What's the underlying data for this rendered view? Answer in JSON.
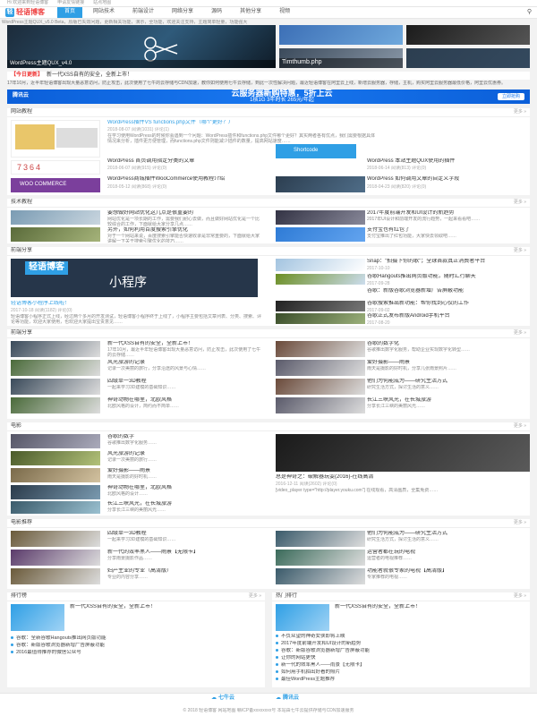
{
  "top_bar": [
    "Hi 欢迎来到轻语博客",
    "申请友情链接",
    "站点地图"
  ],
  "logo": {
    "text": "轻语博客",
    "mark": "轻"
  },
  "nav": {
    "items": [
      "首页",
      "网站技术",
      "前端设计",
      "网络分享",
      "源码",
      "其他分享",
      "视频"
    ],
    "active": 0
  },
  "notice": "WordPress主题QUX_v5.0 Beta，原版已失效问题，更新相关功能，演示，全功能，欢迎关注支持，主题简单轻量，功能强大",
  "hero": {
    "slides": [
      {
        "caption": "WordPress主题QUX_v4.0"
      },
      {
        "caption": "Timthumb.php"
      },
      {
        "caption": ""
      },
      {
        "caption": ""
      },
      {
        "caption": ""
      }
    ]
  },
  "ticker": {
    "tag": "【今日更新】",
    "headline": "新一代XSS自有的安全，全新上市！"
  },
  "ticker_excerpt": "17年10月，近半年轻语博客出现大量恶意访问，防止攻击，此次使用了七牛的云存储与CDN加速，教你如何使用七牛云存储，到此一次性解决问题，最近轻语博客在阿里云上线，新增云服务器，存储，主机，购买阿里云服务器最低价格，阿里云优惠券。",
  "ad": {
    "brand": "腾讯云",
    "line1": "云服务器新购特惠，5折上云",
    "line2": "1核1G 3年时长 265元/年起",
    "button": "立即抢购"
  },
  "more": "更多 »",
  "s1": {
    "title": "网站教程",
    "featured": {
      "title": "WordPress插件VS functions.php文件（哪个更好？）",
      "meta": "2018-08-07    阅读(1031)    评论(1)",
      "excerpt": "在学习使用WordPress的时候你会遇到一个问题：WordPress插件和functions.php文件哪个更好？其实两者各有优点，我们需要根据具体情况来分析，插件更方便管理，而functions.php文件则能减少插件的数量，提高网站速度……"
    },
    "banner_text": "Shortcode",
    "side_top": {
      "title": "WordPress 本站主题QUX使用的插件",
      "meta": "2018-06-14    阅读(813)    评论(0)"
    },
    "grid": [
      {
        "title": "WordPress 首页调用指定分类的文章",
        "meta": "2018-06-07    阅读(915)    评论(0)"
      },
      {
        "title": "WordPress商城插件WooCommerce使用教程介绍",
        "meta": "2018-05-12    阅读(868)    评论(0)"
      },
      {
        "title": "WordPress 如何调用文章的自定义字段",
        "meta": "2018-04-23    阅读(820)    评论(0)"
      }
    ]
  },
  "s2": {
    "title": "技术教程",
    "items": [
      {
        "title": "要想做好网站优化这几点是很重要的",
        "excerpt": "网站优化是一项长期的工作，需要我们耐心去做，而且做好网站优化是一个比较综合的工作，下面就给大家分享几点……"
      },
      {
        "title": "另外，如何利用百度搜索引擎优化",
        "excerpt": "对于一个网站来说，百度搜索引擎能否快速收录是非常重要的，下面就给大家讲解一下关于搜索引擎优化的技巧……"
      },
      {
        "title": "2017年度前端开发和UI设计的新趋势",
        "excerpt": "2017年UI设计和前端开发的流行趋势，一起来看看吧……"
      },
      {
        "title": "支付宝也有红包了",
        "excerpt": "支付宝推出了红包功能，大家快去领取吧……"
      }
    ]
  },
  "s3": {
    "title": "前端分享",
    "featured": {
      "logo": "轻语博客",
      "subtitle": "小程序",
      "title": "轻语博客小程序上线啦！",
      "meta": "2017-10-18    阅读(1182)    评论(0)",
      "excerpt": "轻语博客小程序正式上线，经过两个多月的开发测试，轻语博客小程序终于上线了，小程序主要包括文章列表、分类、搜索、评论等功能，欢迎大家使用，也欢迎大家提出宝贵意见……"
    },
    "side": [
      {
        "title": "Snap：\"拍摄下你的歌\"；全球首款真正消费者平台",
        "meta": "2017-10-10"
      },
      {
        "title": "谷歌Hangouts推出网页版功能，随时汇行聊天",
        "meta": "2017-09-28"
      },
      {
        "title": "谷歌：新版谷歌浏览器新增广告屏蔽功能",
        "meta": "2017-09-15"
      },
      {
        "title": "谷歌搜索推出新功能：帮你找到心仪的工作",
        "meta": "2017-09-02"
      },
      {
        "title": "谷歌正式发布新版Android手机平台",
        "meta": "2017-08-20"
      }
    ]
  },
  "s4": {
    "title": "前端分享",
    "items": [
      {
        "title": "新一代XSS自有的安全，全新上市！",
        "excerpt": "17年10月，最近半年轻语博客出现大量恶意访问，防止攻击，此次使用了七牛的云存储……"
      },
      {
        "title": "谷歌的数字化",
        "excerpt": "谷歌推出数字化服务，帮助企业实现数字化转型……"
      },
      {
        "title": "风光旅游的记录",
        "excerpt": "记录一次美丽的旅行，分享沿途的风景与心情……"
      },
      {
        "title": "爱好摄影——雨景",
        "excerpt": "雨天是摄影的好时机，分享几张雨景照片……"
      },
      {
        "title": "四级单一3D教程",
        "excerpt": "一起来学习3D建模的基础知识……"
      },
      {
        "title": "他们为何能成为——研究生活方式",
        "excerpt": "研究生活方式，探讨生活的意义……"
      },
      {
        "title": "神奇动物在哪里，北欧风格",
        "excerpt": "北欧风格的设计，简约而不简单……"
      },
      {
        "title": "长江三峡风光，在长城旅游",
        "excerpt": "分享长江三峡的美丽风光……"
      }
    ]
  },
  "s5": {
    "title": "电影",
    "items": [
      {
        "title": "谷歌的数字",
        "excerpt": "谷歌推出数字化服务……"
      },
      {
        "title": "风光旅游的记录",
        "excerpt": "记录一次美丽的旅行……"
      },
      {
        "title": "爱好摄影——雨景",
        "excerpt": "雨天是摄影的好时机……"
      },
      {
        "title": "神奇动物在哪里，北欧风格",
        "excerpt": "北欧风格的设计……"
      },
      {
        "title": "长江三峡风光，在长城旅游",
        "excerpt": "分享长江三峡的美丽风光……"
      }
    ],
    "feature": {
      "title": "总是神奇之：破解器玩耍(2016)-在线高清",
      "meta": "2016-12-11    阅读(2602)    评论(0)",
      "excerpt": "[video_player type=\"http://player.youku.com\"] 在线观看，高清画质，全集免费……"
    }
  },
  "s6": {
    "title": "电影推荐",
    "items": [
      {
        "title": "四级单一3D教程",
        "excerpt": "一起来学习3D建模的基础知识……"
      },
      {
        "title": "他们为何能成为——研究生活方式",
        "excerpt": "研究生活方式，探讨生活的意义……"
      },
      {
        "title": "新一代的效率黑人——雨景【无限卡】",
        "excerpt": "分享雨景摄影作品……"
      },
      {
        "title": "运营者都在玩的电视",
        "excerpt": "运营者的电视推荐……"
      },
      {
        "title": "妇产主业的专业（高清版）",
        "excerpt": "专业的内容分享……"
      },
      {
        "title": "功能者就很专家的电视【高清版】",
        "excerpt": "专家推荐的电视……"
      }
    ]
  },
  "s7": {
    "left": {
      "title": "排行榜",
      "featured": "新一代XSS自有的安全，全新上市！",
      "list": [
        "谷歌：全新谷歌Hangouts推出网页版功能",
        "谷歌：新版谷歌浏览器新增广告屏蔽功能",
        "2016最值得推荐的微信公众号"
      ]
    },
    "right": {
      "title": "热门排行",
      "featured": "新一代XSS自有的安全，全新上市！",
      "list": [
        "不负众望的神奇女侠即将上映",
        "2017年度前端开发和UI设计的新趋势",
        "谷歌：新版谷歌浏览器新增广告屏蔽功能",
        "让你的网站更快",
        "新一代的效率黑人——雨景【无限卡】",
        "如何用手机拍出好看的照片",
        "最佳WordPress主题推荐"
      ]
    }
  },
  "footer": {
    "logos": [
      "七牛云",
      "腾讯云"
    ],
    "copyright": "© 2018 轻语博客  网站地图  赣ICP备xxxxxxxx号  本站由七牛云提供存储与CDN加速服务"
  }
}
